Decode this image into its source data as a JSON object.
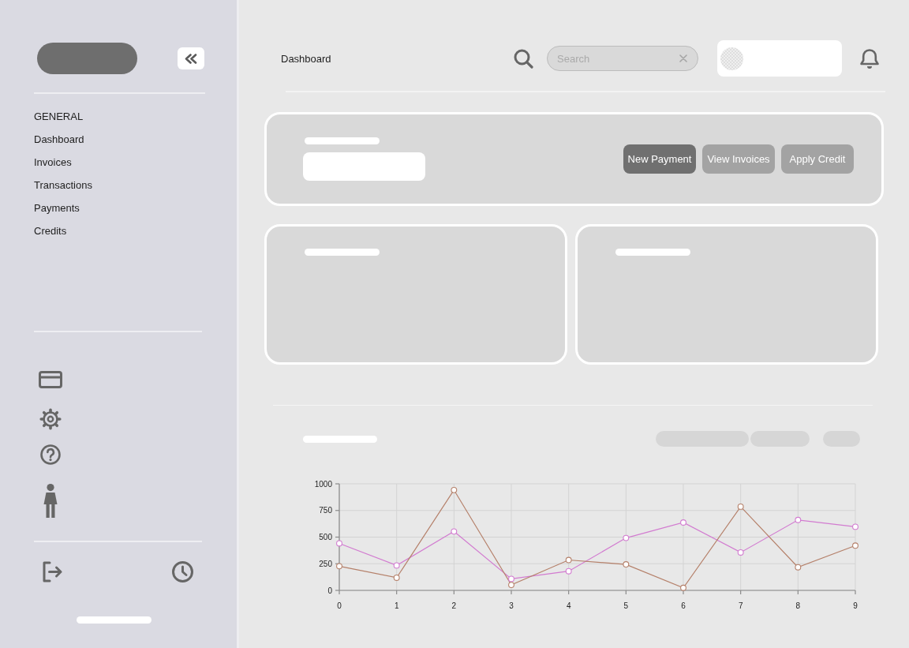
{
  "sidebar": {
    "section_title": "GENERAL",
    "items": [
      "Dashboard",
      "Invoices",
      "Transactions",
      "Payments",
      "Credits"
    ]
  },
  "header": {
    "title": "Dashboard",
    "search": {
      "placeholder": "Search"
    }
  },
  "summary": {
    "actions": [
      {
        "label": "New Payment",
        "kind": "primary"
      },
      {
        "label": "View Invoices",
        "kind": "secondary"
      },
      {
        "label": "Apply Credit",
        "kind": "secondary"
      }
    ]
  },
  "chart": {
    "chart_data": {
      "type": "line",
      "x": [
        0,
        1,
        2,
        3,
        4,
        5,
        6,
        7,
        8,
        9
      ],
      "xlim": [
        0,
        9
      ],
      "ylim": [
        0,
        1000
      ],
      "xticks": [
        0,
        1,
        2,
        3,
        4,
        5,
        6,
        7,
        8,
        9
      ],
      "yticks": [
        0,
        250,
        500,
        750,
        1000
      ],
      "grid": true,
      "series": [
        {
          "color": "#d27bd0",
          "marker": "circle",
          "values": [
            441,
            234,
            553,
            108,
            180,
            492,
            637,
            356,
            661,
            597
          ]
        },
        {
          "color": "#b5806a",
          "marker": "circle",
          "values": [
            227,
            119,
            942,
            51,
            285,
            244,
            24,
            786,
            217,
            420
          ]
        }
      ]
    }
  }
}
